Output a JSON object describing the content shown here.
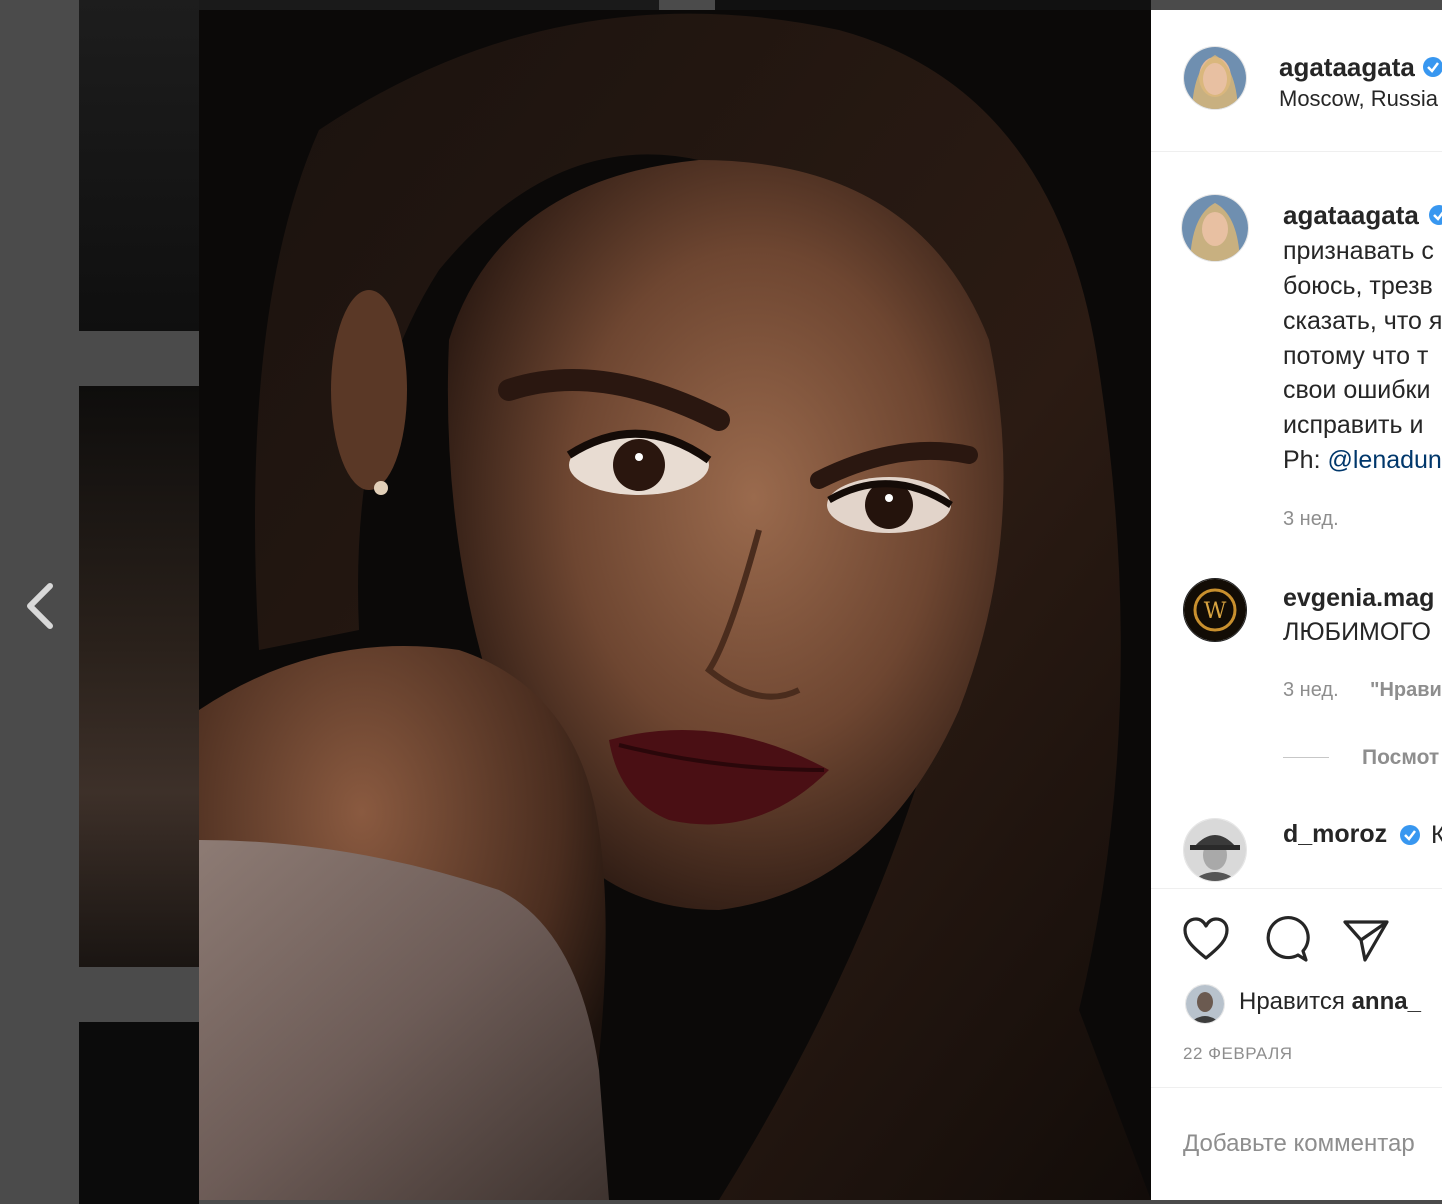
{
  "post": {
    "author": {
      "username": "agataagata",
      "location": "Moscow, Russia"
    },
    "caption": {
      "username": "agataagata",
      "lines": [
        "признавать с",
        "боюсь, трезв",
        "сказать, что я",
        "потому что т",
        "свои ошибки",
        "исправить и "
      ],
      "credit_prefix": "Ph: ",
      "credit_mention": "@lenadun",
      "time": "3 нед."
    },
    "comments": [
      {
        "username": "evgenia.mag",
        "text": "ЛЮБИМОГО",
        "time": "3 нед.",
        "reply_snippet": "\"Нрави",
        "view_replies": "Посмот"
      },
      {
        "username": "d_moroz",
        "text": "К"
      }
    ],
    "likes": {
      "prefix": "Нравится ",
      "user": "anna_"
    },
    "date": "22 ФЕВРАЛЯ",
    "comment_placeholder": "Добавьте комментар"
  },
  "icons": {
    "prev": "chevron-left-icon",
    "verified": "verified-badge-icon",
    "like": "heart-icon",
    "comment": "comment-bubble-icon",
    "share": "paper-plane-icon"
  },
  "colors": {
    "verified": "#3897f0",
    "mention": "#00376b",
    "muted": "#8e8e8e"
  }
}
